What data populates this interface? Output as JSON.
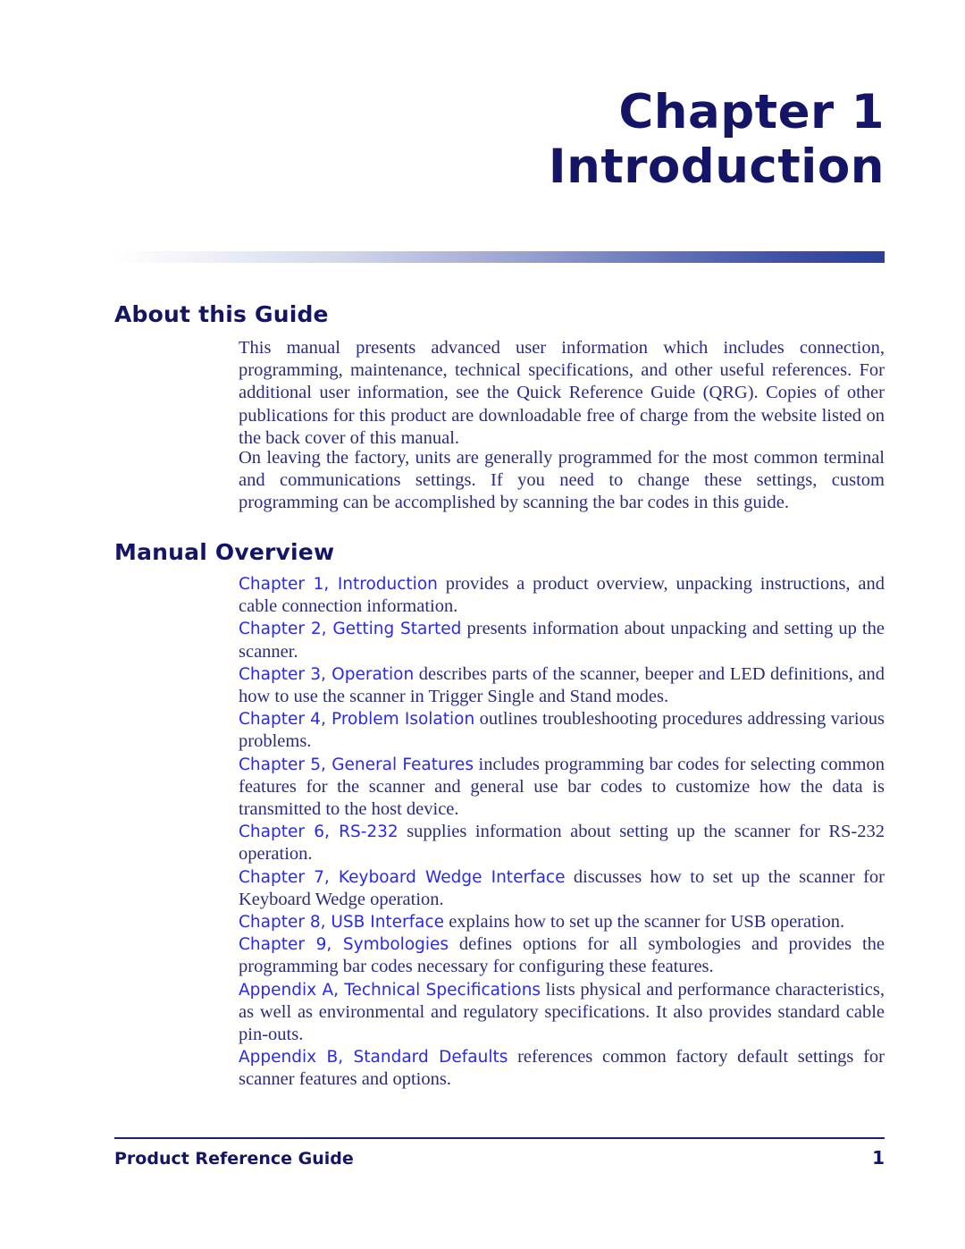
{
  "document": {
    "chapter_number": "Chapter 1",
    "chapter_name": "Introduction"
  },
  "sections": {
    "about": {
      "heading": "About this Guide",
      "paragraph_1": "This manual presents advanced user information which includes connection, programming, maintenance, technical specifications, and other useful references. For additional user information, see the Quick Reference Guide (QRG). Copies of other publications for this product are downloadable free of charge from the website listed on the back cover of this manual.",
      "paragraph_2": "On leaving the factory, units are generally programmed for the most common terminal and communications settings.  If you need to change these settings, custom programming can be accomplished by scanning the bar codes in this guide."
    },
    "overview": {
      "heading": "Manual Overview",
      "entries": [
        {
          "link": "Chapter 1, Introduction",
          "text": " provides a product overview, unpacking instructions, and cable connection information."
        },
        {
          "link": "Chapter 2, Getting Started",
          "text": " presents information about unpacking and setting up the scanner."
        },
        {
          "link": "Chapter 3, Operation",
          "text": " describes parts of the scanner, beeper and LED definitions, and how to use the scanner in Trigger Single and Stand modes."
        },
        {
          "link": "Chapter 4, Problem Isolation",
          "text": " outlines troubleshooting procedures addressing various problems."
        },
        {
          "link": "Chapter 5, General Features",
          "text": " includes programming bar codes for selecting common features for the scanner and general use bar codes to customize how the data is transmitted to the host device."
        },
        {
          "link": "Chapter 6, RS-232",
          "text": " supplies information about setting up the scanner for RS-232 operation."
        },
        {
          "link": "Chapter 7, Keyboard Wedge Interface",
          "text": " discusses how to set up the scanner for Keyboard Wedge operation."
        },
        {
          "link": "Chapter 8, USB Interface",
          "text": " explains how to set up the scanner for USB operation."
        },
        {
          "link": "Chapter 9, Symbologies",
          "text": " defines options for all symbologies and provides the programming bar codes necessary for configuring these features."
        },
        {
          "link": "Appendix A, Technical Specifications",
          "text": " lists physical and performance characteristics, as well as environmental and regulatory specifications. It also provides standard cable pin-outs."
        },
        {
          "link": "Appendix B, Standard Defaults",
          "text": " references common factory default settings for scanner features and options."
        }
      ]
    }
  },
  "footer": {
    "title": "Product Reference Guide",
    "page_number": "1"
  },
  "colors": {
    "heading_navy": "#151568",
    "body_navy": "#2b2b7e",
    "link_blue": "#2a2aee",
    "rule_navy": "#1e1e70",
    "gradient_end": "#2c3f97"
  }
}
